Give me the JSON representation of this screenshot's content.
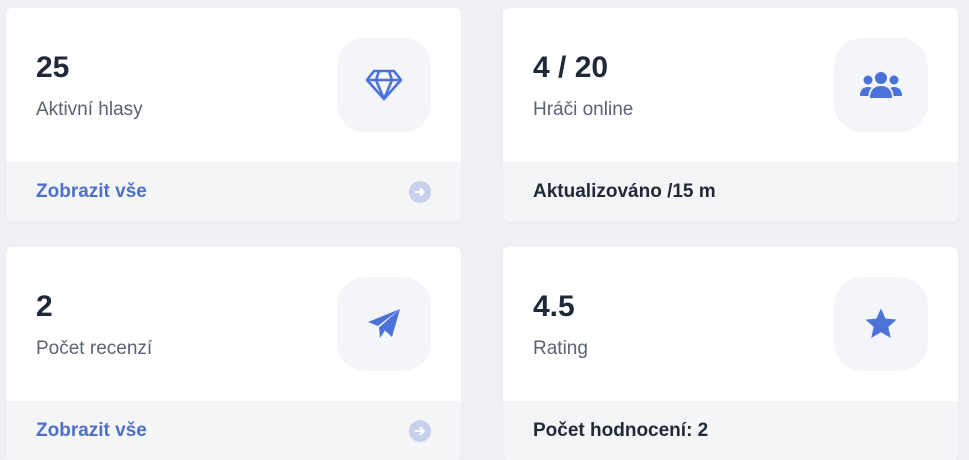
{
  "colors": {
    "page_bg": "#eef0f4",
    "card_bg": "#ffffff",
    "footer_bg": "#f4f5f7",
    "accent": "#4f70c6",
    "icon_color": "#4a72d9",
    "value_text": "#1f2937",
    "label_text": "#5b6270"
  },
  "cards": [
    {
      "value": "25",
      "label": "Aktivní hlasy",
      "icon": "diamond-icon",
      "footer": {
        "type": "link",
        "text": "Zobrazit vše",
        "action_icon": "arrow-circle-right-icon"
      }
    },
    {
      "value": "4 / 20",
      "label": "Hráči online",
      "icon": "users-icon",
      "footer": {
        "type": "text",
        "text": "Aktualizováno /15 m"
      }
    },
    {
      "value": "2",
      "label": "Počet recenzí",
      "icon": "paper-plane-icon",
      "footer": {
        "type": "link",
        "text": "Zobrazit vše",
        "action_icon": "arrow-circle-right-icon"
      }
    },
    {
      "value": "4.5",
      "label": "Rating",
      "icon": "star-icon",
      "footer": {
        "type": "text",
        "text": "Počet hodnocení: 2"
      }
    }
  ]
}
